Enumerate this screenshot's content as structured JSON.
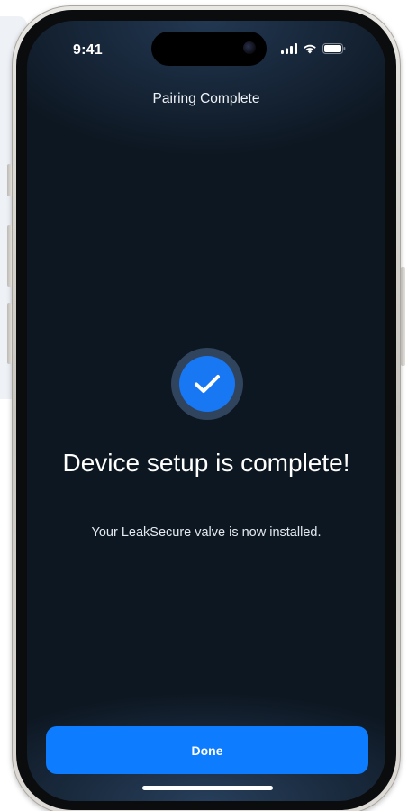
{
  "status_bar": {
    "time": "9:41",
    "icons": [
      "cellular-signal-icon",
      "wifi-icon",
      "battery-icon"
    ]
  },
  "nav": {
    "title": "Pairing Complete"
  },
  "success": {
    "icon": "checkmark-icon",
    "headline": "Device setup is complete!",
    "message": "Your LeakSecure valve is now installed."
  },
  "actions": {
    "done_label": "Done"
  },
  "colors": {
    "accent": "#0d7cff",
    "background": "#0d1722",
    "icon_ring": "#30445e"
  }
}
